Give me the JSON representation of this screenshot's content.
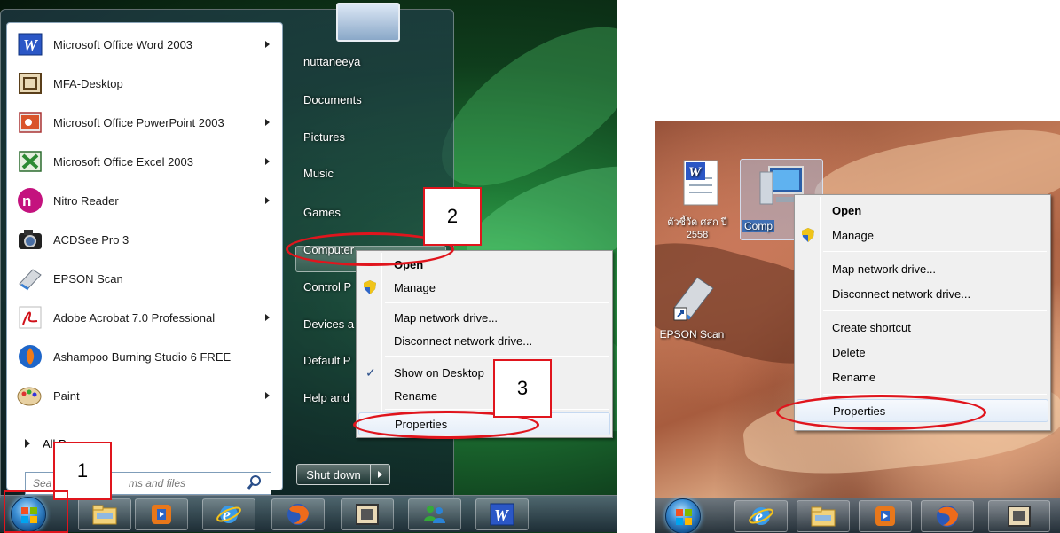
{
  "left": {
    "programs": [
      {
        "label": "Microsoft Office Word 2003",
        "icon": "word-icon",
        "submenu": true
      },
      {
        "label": "MFA-Desktop",
        "icon": "window-icon",
        "submenu": false
      },
      {
        "label": "Microsoft Office PowerPoint 2003",
        "icon": "powerpoint-icon",
        "submenu": true
      },
      {
        "label": "Microsoft Office Excel 2003",
        "icon": "excel-icon",
        "submenu": true
      },
      {
        "label": "Nitro Reader",
        "icon": "nitro-icon",
        "submenu": true
      },
      {
        "label": "ACDSee Pro 3",
        "icon": "camera-icon",
        "submenu": false
      },
      {
        "label": "EPSON Scan",
        "icon": "scanner-icon",
        "submenu": false
      },
      {
        "label": "Adobe Acrobat 7.0 Professional",
        "icon": "acrobat-icon",
        "submenu": true
      },
      {
        "label": "Ashampoo Burning Studio 6 FREE",
        "icon": "burn-icon",
        "submenu": false
      },
      {
        "label": "Paint",
        "icon": "paint-icon",
        "submenu": true
      }
    ],
    "all_programs": "All Programs",
    "search_placeholder": "Search programs and files",
    "search_visible_left": "Sea",
    "search_visible_right": "ms and files",
    "right_items": [
      "nuttaneeya",
      "Documents",
      "Pictures",
      "Music",
      "Games",
      "Computer",
      "Control P",
      "Devices a",
      "Default P",
      "Help and"
    ],
    "shutdown_label": "Shut down",
    "context_menu": {
      "open": "Open",
      "manage": "Manage",
      "map_drive": "Map network drive...",
      "disconnect_drive": "Disconnect network drive...",
      "show_desktop": "Show on Desktop",
      "rename": "Rename",
      "properties": "Properties"
    },
    "taskbar_icons": [
      "explorer-icon",
      "media-player-icon",
      "internet-explorer-icon",
      "firefox-icon",
      "window-icon",
      "messenger-icon",
      "word-icon"
    ],
    "callouts": [
      "1",
      "2",
      "3"
    ]
  },
  "right": {
    "desktop_icons": [
      {
        "label": "ตัวชี้วัด ศสก ปี 2558",
        "icon": "word-document-icon"
      },
      {
        "label": "Comp",
        "icon": "computer-icon"
      },
      {
        "label": "EPSON Scan",
        "icon": "scanner-icon"
      }
    ],
    "context_menu": {
      "open": "Open",
      "manage": "Manage",
      "map_drive": "Map network drive...",
      "disconnect_drive": "Disconnect network drive...",
      "create_shortcut": "Create shortcut",
      "delete": "Delete",
      "rename": "Rename",
      "properties": "Properties"
    },
    "taskbar_icons": [
      "internet-explorer-icon",
      "explorer-icon",
      "media-player-icon",
      "firefox-icon",
      "window-icon"
    ]
  },
  "colors": {
    "annotation_red": "#e0151d",
    "menu_bg": "#f0f0f0",
    "menu_hover": "#e5eef9"
  }
}
